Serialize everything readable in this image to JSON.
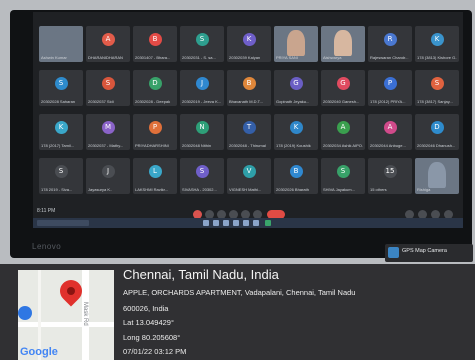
{
  "meeting": {
    "clock": "8:11 PM",
    "participants": [
      {
        "name": "Ashwin Kumar",
        "initial": "",
        "color": "#6b7684",
        "video": true
      },
      {
        "name": "DHARANIDHARAN",
        "initial": "A",
        "color": "#e25c4a",
        "video": false
      },
      {
        "name": "20301407 - Bhara...",
        "initial": "B",
        "color": "#e34b46",
        "video": false
      },
      {
        "name": "20302031 - S. sa...",
        "initial": "S",
        "color": "#2e9f8f",
        "video": false
      },
      {
        "name": "20302039 Kalyan",
        "initial": "K",
        "color": "#6f5fc9",
        "video": false
      },
      {
        "name": "PRIYA SANI",
        "initial": "",
        "color": "#c9a58e",
        "video": true
      },
      {
        "name": "Aishwarya",
        "initial": "",
        "color": "#d7b7a0",
        "video": true
      },
      {
        "name": "Rajeswaran Chandr...",
        "initial": "R",
        "color": "#4a78d0",
        "video": false
      },
      {
        "name": "178 (3813) Kishore G...",
        "initial": "K",
        "color": "#3a94cc",
        "video": false
      },
      {
        "name": "20302028 Saharan",
        "initial": "S",
        "color": "#2e8bcc",
        "video": false
      },
      {
        "name": "20302037 Sidi",
        "initial": "S",
        "color": "#d8563c",
        "video": false
      },
      {
        "name": "20302028 - Deepak",
        "initial": "D",
        "color": "#38a169",
        "video": false
      },
      {
        "name": "20302019 - Jeeva K...",
        "initial": "J",
        "color": "#2f88d0",
        "video": false
      },
      {
        "name": "Bhavanath M.D.T...",
        "initial": "B",
        "color": "#e0873a",
        "video": false
      },
      {
        "name": "Gopinath Jeyaku...",
        "initial": "G",
        "color": "#6a5ec4",
        "video": false
      },
      {
        "name": "20302040 Ganesh...",
        "initial": "G",
        "color": "#e04b60",
        "video": false
      },
      {
        "name": "178 (2012) PRIYA...",
        "initial": "P",
        "color": "#3a6fd4",
        "video": false
      },
      {
        "name": "178 (3817) Sanjay...",
        "initial": "S",
        "color": "#e0623f",
        "video": false
      },
      {
        "name": "178 (2017) Tamil...",
        "initial": "K",
        "color": "#3aa7c9",
        "video": false
      },
      {
        "name": "20302037 - Mathy...",
        "initial": "M",
        "color": "#8a63c8",
        "video": false
      },
      {
        "name": "PRIYADHARSHINI",
        "initial": "P",
        "color": "#e0703a",
        "video": false
      },
      {
        "name": "20302048 Nithin",
        "initial": "N",
        "color": "#2e9f78",
        "video": false
      },
      {
        "name": "20302048 - Thirumal",
        "initial": "T",
        "color": "#345fa8",
        "video": false
      },
      {
        "name": "178 (2019) Koushik",
        "initial": "K",
        "color": "#2f87c9",
        "video": false
      },
      {
        "name": "20302034 Ashik AIPO...",
        "initial": "A",
        "color": "#3a9f4e",
        "video": false
      },
      {
        "name": "20302044 Anbuge...",
        "initial": "A",
        "color": "#d04a8a",
        "video": false
      },
      {
        "name": "20302046 Dhanush...",
        "initial": "D",
        "color": "#2e8bcc",
        "video": false
      },
      {
        "name": "178 2019 - Siva...",
        "initial": "S",
        "color": "#4a4d52",
        "video": false
      },
      {
        "name": "Jayasurya K..",
        "initial": "J",
        "color": "#4a4d52",
        "video": false
      },
      {
        "name": "LAKSHMI Ravikr...",
        "initial": "L",
        "color": "#3aa7c9",
        "video": false
      },
      {
        "name": "SIVASHA - 20302...",
        "initial": "S",
        "color": "#6f5fc9",
        "video": false
      },
      {
        "name": "VIGNESH Mathi...",
        "initial": "V",
        "color": "#2e9fa8",
        "video": false
      },
      {
        "name": "20302026 Bharath",
        "initial": "B",
        "color": "#2f88d0",
        "video": false
      },
      {
        "name": "SHIVA Jayakum...",
        "initial": "S",
        "color": "#38a169",
        "video": false
      },
      {
        "name": "15 others",
        "initial": "15",
        "color": "#4a4d52",
        "video": false
      },
      {
        "name": "Rishiga",
        "initial": "",
        "color": "#8a97a8",
        "video": true
      }
    ]
  },
  "laptop_brand": "Lenovo",
  "gps_badge": "GPS Map Camera",
  "location": {
    "city": "Chennai, Tamil Nadu, India",
    "address": "APPLE, ORCHARDS APARTMENT, Vadapalani, Chennai, Tamil Nadu",
    "postcode": "600026, India",
    "lat": "Lat 13.049429°",
    "long": "Long 80.205608°",
    "datetime": "07/01/22 03:12 PM"
  },
  "map": {
    "street_label": "Mask Rd",
    "provider": "Google"
  }
}
